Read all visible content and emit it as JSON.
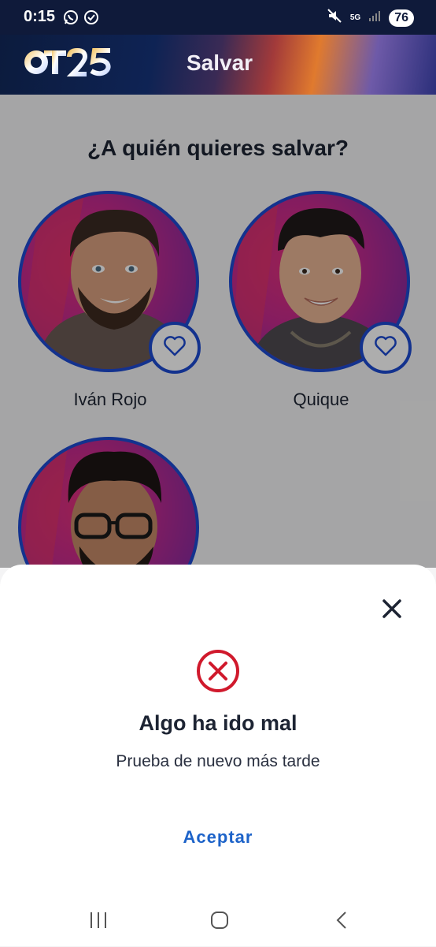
{
  "status_bar": {
    "time": "0:15",
    "network": "5G",
    "battery": "76",
    "icons": [
      "whatsapp-icon",
      "check-circle-icon",
      "mute-icon",
      "signal-icon"
    ]
  },
  "header": {
    "logo_text": "OT25",
    "title": "Salvar"
  },
  "main": {
    "question": "¿A quién quieres salvar?",
    "candidates": [
      {
        "name": "Iván Rojo"
      },
      {
        "name": "Quique"
      },
      {
        "name": ""
      }
    ]
  },
  "sheet": {
    "title": "Algo ha ido mal",
    "message": "Prueba de nuevo más tarde",
    "accept_label": "Aceptar"
  },
  "colors": {
    "accent": "#1d4bd1",
    "error": "#d0192c",
    "link": "#1d63c9",
    "header_dark": "#0f1a3a"
  }
}
